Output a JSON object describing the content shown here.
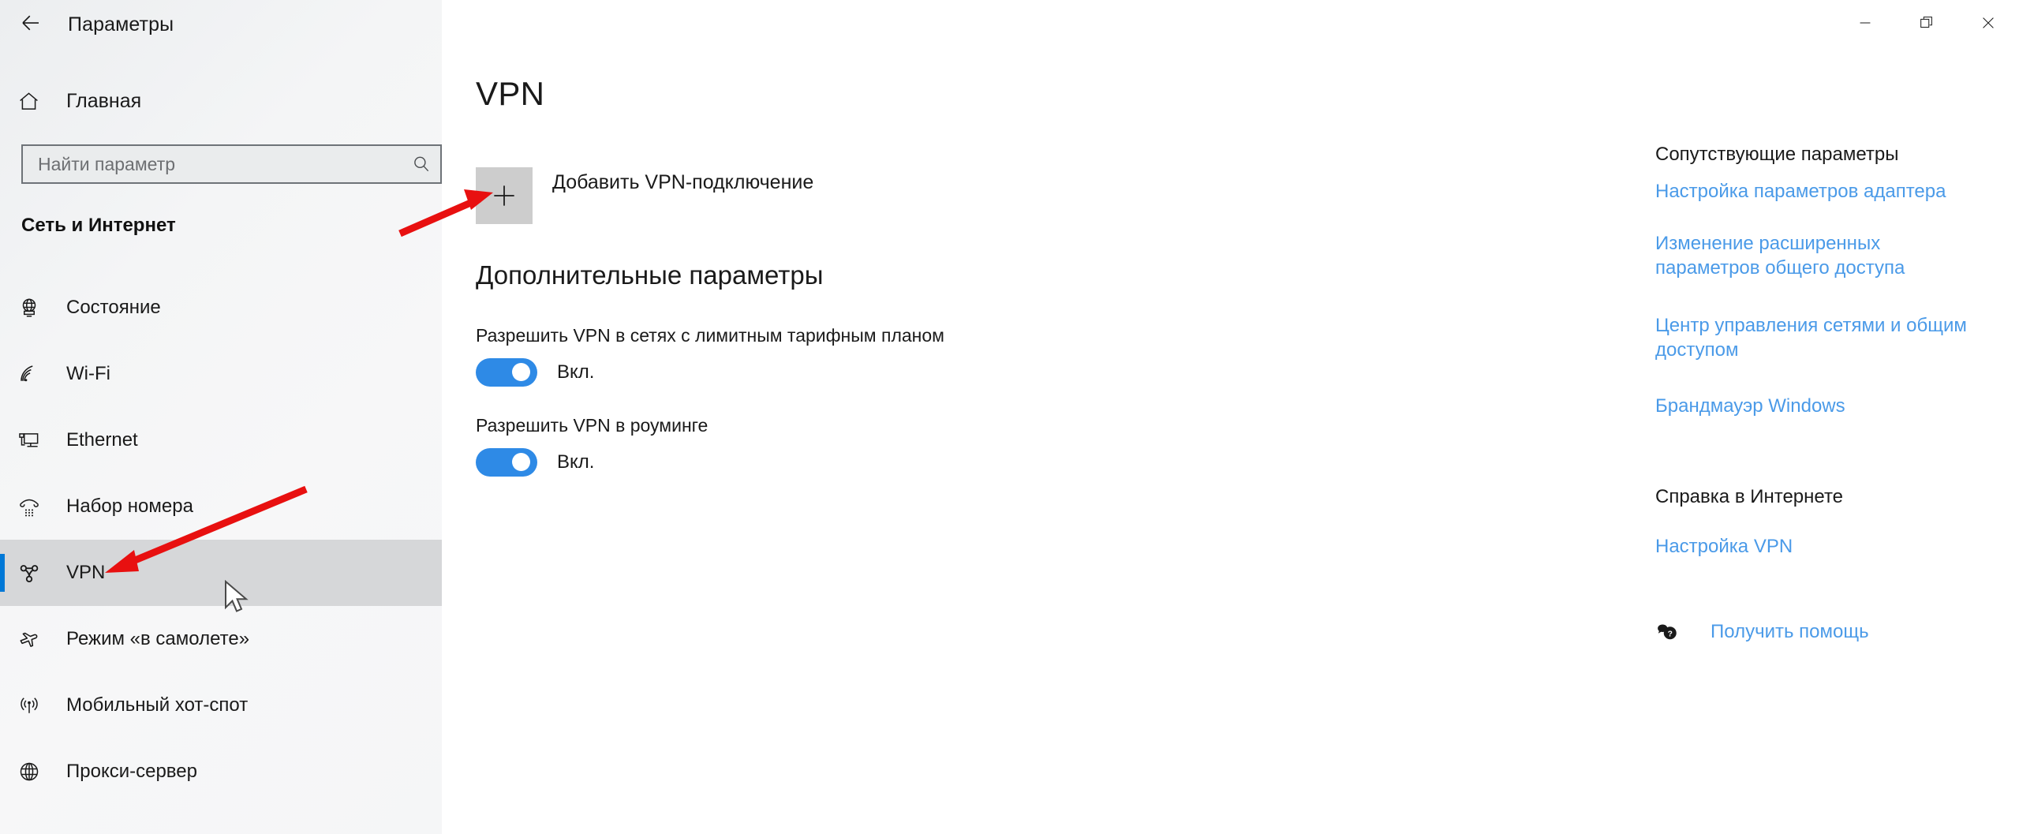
{
  "window": {
    "title": "Параметры",
    "back_icon": "back-arrow-icon",
    "controls": {
      "minimize": "minimize-icon",
      "restore": "restore-icon",
      "close": "close-icon"
    }
  },
  "sidebar": {
    "home": {
      "label": "Главная",
      "icon": "home-icon"
    },
    "search": {
      "placeholder": "Найти параметр",
      "value": "",
      "icon": "search-icon"
    },
    "category": "Сеть и Интернет",
    "items": [
      {
        "label": "Состояние",
        "icon": "globe-monitor-icon",
        "selected": false
      },
      {
        "label": "Wi-Fi",
        "icon": "wifi-icon",
        "selected": false
      },
      {
        "label": "Ethernet",
        "icon": "ethernet-icon",
        "selected": false
      },
      {
        "label": "Набор номера",
        "icon": "dialup-phone-icon",
        "selected": false
      },
      {
        "label": "VPN",
        "icon": "vpn-icon",
        "selected": true
      },
      {
        "label": "Режим «в самолете»",
        "icon": "airplane-icon",
        "selected": false
      },
      {
        "label": "Мобильный хот-спот",
        "icon": "hotspot-icon",
        "selected": false
      },
      {
        "label": "Прокси-сервер",
        "icon": "proxy-globe-icon",
        "selected": false
      }
    ]
  },
  "main": {
    "page_title": "VPN",
    "add_connection": {
      "label": "Добавить VPN-подключение",
      "icon": "plus-icon"
    },
    "section_title": "Дополнительные параметры",
    "settings": [
      {
        "caption": "Разрешить VPN в сетях с лимитным тарифным планом",
        "state_label": "Вкл.",
        "on": true
      },
      {
        "caption": "Разрешить VPN в роуминге",
        "state_label": "Вкл.",
        "on": true
      }
    ]
  },
  "right_panel": {
    "related_heading": "Сопутствующие параметры",
    "related_links": [
      "Настройка параметров адаптера",
      "Изменение расширенных параметров общего доступа",
      "Центр управления сетями и общим доступом",
      "Брандмауэр Windows"
    ],
    "help_heading": "Справка в Интернете",
    "help_links": [
      "Настройка VPN"
    ],
    "get_help": {
      "label": "Получить помощь",
      "icon": "help-chat-icon"
    }
  },
  "annotations": {
    "accent_color": "#0078d7",
    "arrow_color": "#e81010",
    "toggle_on_color": "#2e8ae6",
    "link_color": "#4a9ae8",
    "arrows": [
      {
        "name": "arrow-to-add-vpn-button"
      },
      {
        "name": "arrow-to-vpn-sidebar-item"
      }
    ],
    "cursor": {
      "name": "mouse-pointer"
    }
  }
}
